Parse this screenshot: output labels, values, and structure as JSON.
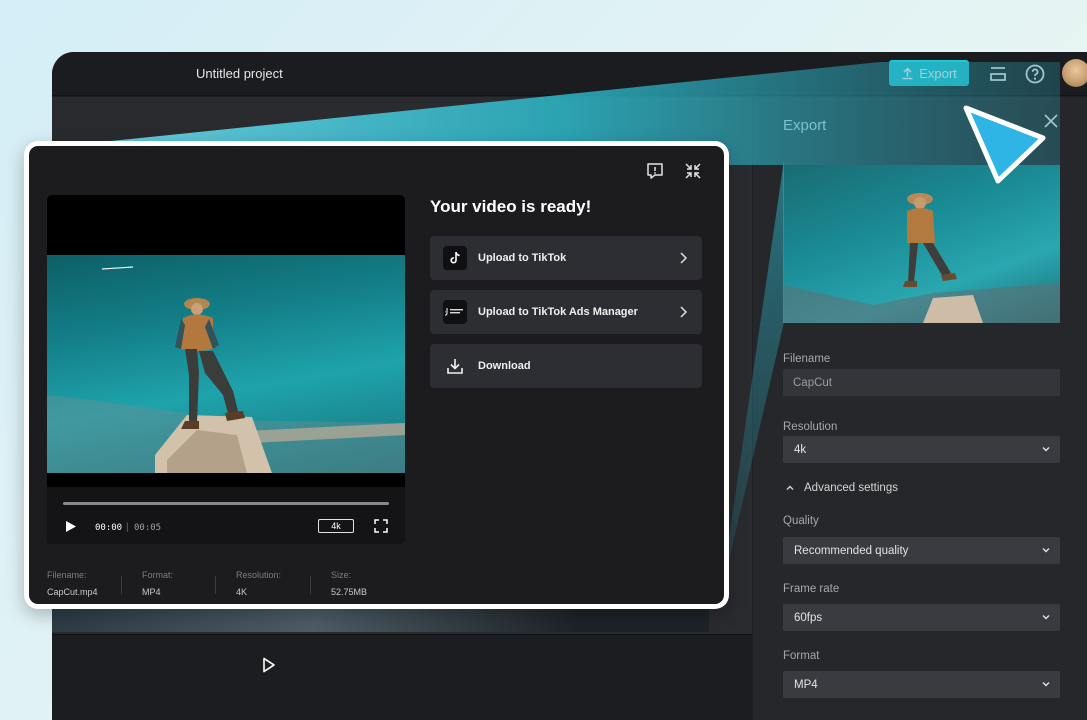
{
  "header": {
    "project_title": "Untitled project",
    "export_label": "Export",
    "icons": [
      "upload-icon",
      "layers-icon",
      "help-icon",
      "avatar"
    ]
  },
  "export_panel": {
    "title": "Export",
    "filename_label": "Filename",
    "filename_value": "CapCut",
    "resolution_label": "Resolution",
    "resolution_value": "4k",
    "advanced_label": "Advanced settings",
    "quality_label": "Quality",
    "quality_value": "Recommended quality",
    "framerate_label": "Frame rate",
    "framerate_value": "60fps",
    "format_label": "Format",
    "format_value": "MP4"
  },
  "popup": {
    "title": "Your video is ready!",
    "actions": [
      {
        "label": "Upload to TikTok",
        "icon": "tiktok-icon"
      },
      {
        "label": "Upload to TikTok Ads Manager",
        "icon": "tiktok-ads-icon"
      },
      {
        "label": "Download",
        "icon": "download-icon"
      }
    ],
    "player": {
      "current_time": "00:00",
      "separator": "|",
      "total_time": "00:05",
      "quality_badge": "4k"
    },
    "meta": [
      {
        "label": "Filename:",
        "value": "CapCut.mp4"
      },
      {
        "label": "Format:",
        "value": "MP4"
      },
      {
        "label": "Resolution:",
        "value": "4K"
      },
      {
        "label": "Size:",
        "value": "52.75MB"
      }
    ]
  },
  "colors": {
    "accent": "#1fc6d6",
    "panel_bg": "#26272b",
    "popup_bg": "#1c1c1f",
    "cursor": "#2fb4e6"
  }
}
